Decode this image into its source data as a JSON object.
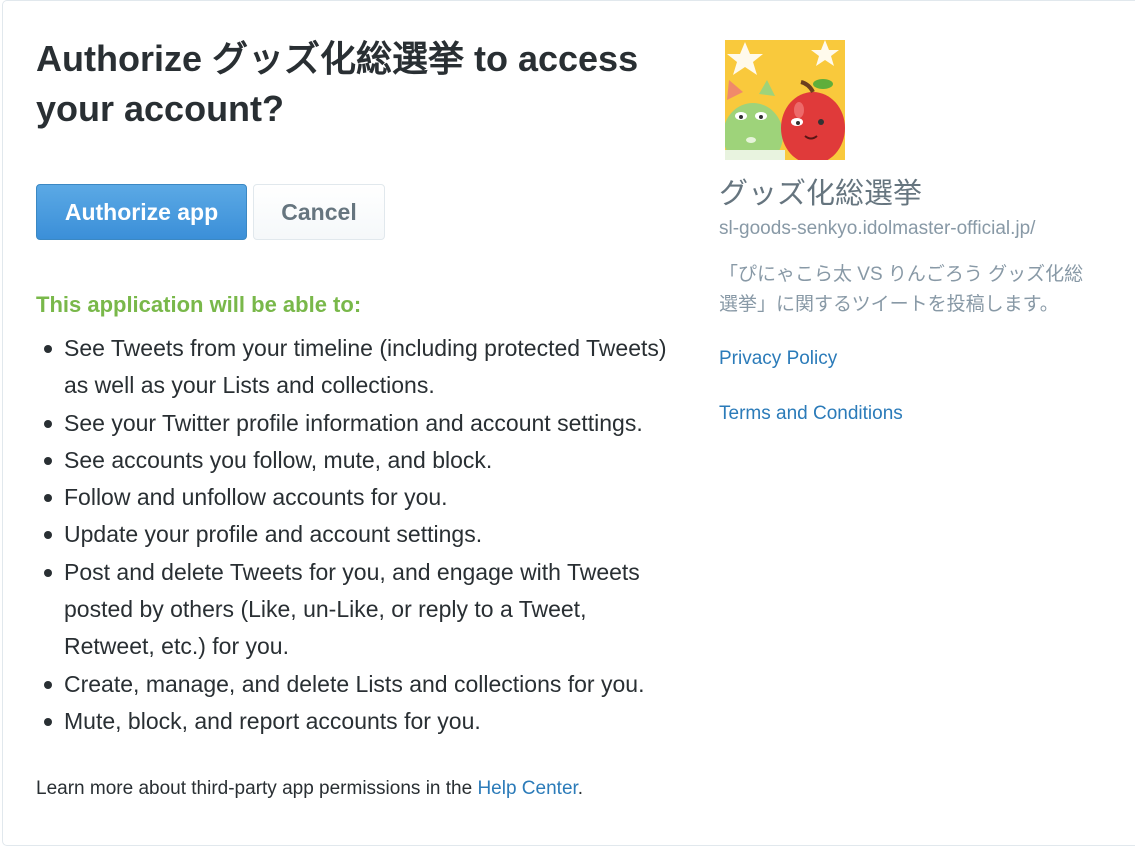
{
  "page": {
    "title": "Authorize グッズ化総選挙 to access your account?"
  },
  "actions": {
    "authorize_label": "Authorize app",
    "cancel_label": "Cancel"
  },
  "permissions": {
    "heading": "This application will be able to:",
    "items": [
      "See Tweets from your timeline (including protected Tweets) as well as your Lists and collections.",
      "See your Twitter profile information and account settings.",
      "See accounts you follow, mute, and block.",
      "Follow and unfollow accounts for you.",
      "Update your profile and account settings.",
      "Post and delete Tweets for you, and engage with Tweets posted by others (Like, un-Like, or reply to a Tweet, Retweet, etc.) for you.",
      "Create, manage, and delete Lists and collections for you.",
      "Mute, block, and report accounts for you."
    ]
  },
  "footer": {
    "text_before": "Learn more about third-party app permissions in the ",
    "link_label": "Help Center",
    "text_after": "."
  },
  "app": {
    "icon": "app-logo-characters",
    "name": "グッズ化総選挙",
    "url": "sl-goods-senkyo.idolmaster-official.jp/",
    "description": "「ぴにゃこら太 VS りんごろう グッズ化総選挙」に関するツイートを投稿します。",
    "privacy_label": "Privacy Policy",
    "terms_label": "Terms and Conditions"
  },
  "colors": {
    "primary_button": "#3b8fd8",
    "permission_heading": "#79b84a",
    "link": "#2b7bb9"
  }
}
